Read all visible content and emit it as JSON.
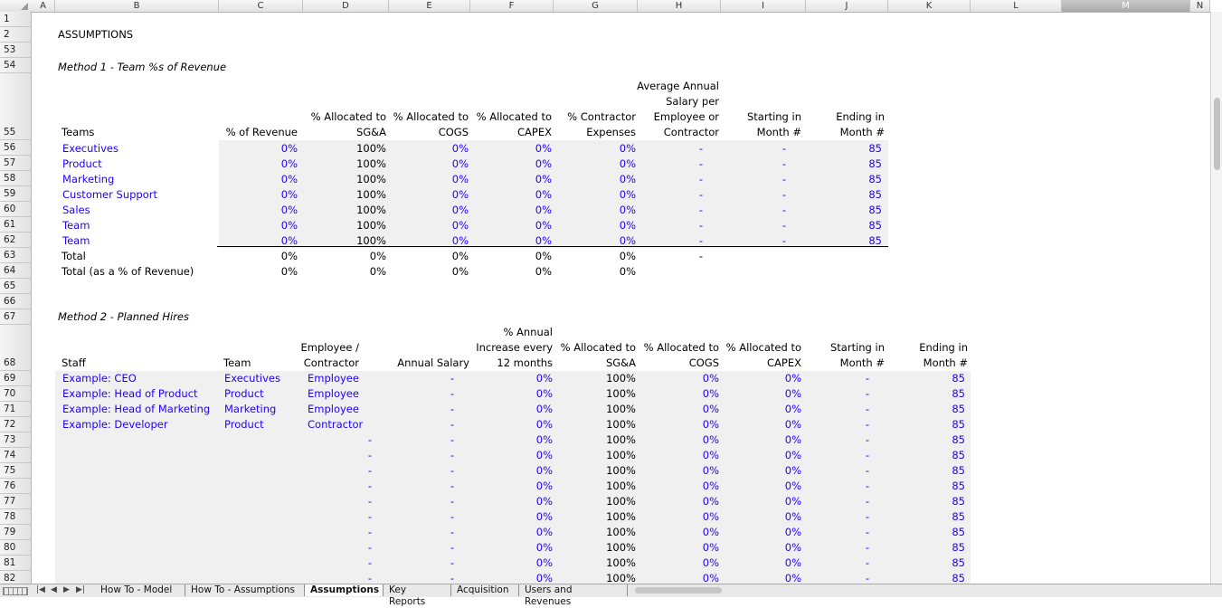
{
  "columns": [
    "A",
    "B",
    "C",
    "D",
    "E",
    "F",
    "G",
    "H",
    "I",
    "J",
    "K",
    "L",
    "M",
    "N"
  ],
  "selected_column": "M",
  "rows": [
    "1",
    "2",
    "53",
    "54",
    "55",
    "56",
    "57",
    "58",
    "59",
    "60",
    "61",
    "62",
    "63",
    "64",
    "65",
    "66",
    "67",
    "68",
    "69",
    "70",
    "71",
    "72",
    "73",
    "74",
    "75",
    "76",
    "77",
    "78",
    "79",
    "80",
    "81",
    "82"
  ],
  "title": "ASSUMPTIONS",
  "method1": {
    "label": "Method 1 - Team %s of Revenue",
    "headers": {
      "teams": "Teams",
      "pct_revenue": "% of Revenue",
      "alloc_sga": [
        "% Allocated to",
        "SG&A"
      ],
      "alloc_cogs": [
        "% Allocated to",
        "COGS"
      ],
      "alloc_capex": [
        "% Allocated to",
        "CAPEX"
      ],
      "contractor": [
        "% Contractor",
        "Expenses"
      ],
      "avg_salary": [
        "Average Annual",
        "Salary per",
        "Employee or",
        "Contractor"
      ],
      "starting": [
        "Starting in",
        "Month #"
      ],
      "ending": [
        "Ending in",
        "Month #"
      ]
    },
    "teams": [
      {
        "name": "Executives",
        "rev": "0%",
        "sga": "100%",
        "cogs": "0%",
        "capex": "0%",
        "contr": "0%",
        "salary": "-",
        "start": "-",
        "end": "85"
      },
      {
        "name": "Product",
        "rev": "0%",
        "sga": "100%",
        "cogs": "0%",
        "capex": "0%",
        "contr": "0%",
        "salary": "-",
        "start": "-",
        "end": "85"
      },
      {
        "name": "Marketing",
        "rev": "0%",
        "sga": "100%",
        "cogs": "0%",
        "capex": "0%",
        "contr": "0%",
        "salary": "-",
        "start": "-",
        "end": "85"
      },
      {
        "name": "Customer Support",
        "rev": "0%",
        "sga": "100%",
        "cogs": "0%",
        "capex": "0%",
        "contr": "0%",
        "salary": "-",
        "start": "-",
        "end": "85"
      },
      {
        "name": "Sales",
        "rev": "0%",
        "sga": "100%",
        "cogs": "0%",
        "capex": "0%",
        "contr": "0%",
        "salary": "-",
        "start": "-",
        "end": "85"
      },
      {
        "name": "Team",
        "rev": "0%",
        "sga": "100%",
        "cogs": "0%",
        "capex": "0%",
        "contr": "0%",
        "salary": "-",
        "start": "-",
        "end": "85"
      },
      {
        "name": "Team",
        "rev": "0%",
        "sga": "100%",
        "cogs": "0%",
        "capex": "0%",
        "contr": "0%",
        "salary": "-",
        "start": "-",
        "end": "85"
      }
    ],
    "total": {
      "label": "Total",
      "rev": "0%",
      "sga": "0%",
      "cogs": "0%",
      "capex": "0%",
      "contr": "0%",
      "salary": "-"
    },
    "total_pct": {
      "label": "Total (as a % of Revenue)",
      "rev": "0%",
      "sga": "0%",
      "cogs": "0%",
      "capex": "0%",
      "contr": "0%"
    }
  },
  "method2": {
    "label": "Method 2 - Planned Hires",
    "headers": {
      "staff": "Staff",
      "team": "Team",
      "emp": [
        "Employee /",
        "Contractor"
      ],
      "salary": "Annual Salary",
      "increase": [
        "% Annual",
        "Increase every",
        "12 months"
      ],
      "sga": [
        "% Allocated to",
        "SG&A"
      ],
      "cogs": [
        "% Allocated to",
        "COGS"
      ],
      "capex": [
        "% Allocated to",
        "CAPEX"
      ],
      "starting": [
        "Starting in",
        "Month #"
      ],
      "ending": [
        "Ending in",
        "Month #"
      ]
    },
    "hires": [
      {
        "staff": "Example: CEO",
        "team": "Executives",
        "emp": "Employee",
        "salary": "-",
        "inc": "0%",
        "sga": "100%",
        "cogs": "0%",
        "capex": "0%",
        "start": "-",
        "end": "85"
      },
      {
        "staff": "Example: Head of Product",
        "team": "Product",
        "emp": "Employee",
        "salary": "-",
        "inc": "0%",
        "sga": "100%",
        "cogs": "0%",
        "capex": "0%",
        "start": "-",
        "end": "85"
      },
      {
        "staff": "Example: Head of Marketing",
        "team": "Marketing",
        "emp": "Employee",
        "salary": "-",
        "inc": "0%",
        "sga": "100%",
        "cogs": "0%",
        "capex": "0%",
        "start": "-",
        "end": "85"
      },
      {
        "staff": "Example: Developer",
        "team": "Product",
        "emp": "Contractor",
        "salary": "-",
        "inc": "0%",
        "sga": "100%",
        "cogs": "0%",
        "capex": "0%",
        "start": "-",
        "end": "85"
      },
      {
        "staff": "",
        "team": "",
        "emp": "-",
        "salary": "-",
        "inc": "0%",
        "sga": "100%",
        "cogs": "0%",
        "capex": "0%",
        "start": "-",
        "end": "85"
      },
      {
        "staff": "",
        "team": "",
        "emp": "-",
        "salary": "-",
        "inc": "0%",
        "sga": "100%",
        "cogs": "0%",
        "capex": "0%",
        "start": "-",
        "end": "85"
      },
      {
        "staff": "",
        "team": "",
        "emp": "-",
        "salary": "-",
        "inc": "0%",
        "sga": "100%",
        "cogs": "0%",
        "capex": "0%",
        "start": "-",
        "end": "85"
      },
      {
        "staff": "",
        "team": "",
        "emp": "-",
        "salary": "-",
        "inc": "0%",
        "sga": "100%",
        "cogs": "0%",
        "capex": "0%",
        "start": "-",
        "end": "85"
      },
      {
        "staff": "",
        "team": "",
        "emp": "-",
        "salary": "-",
        "inc": "0%",
        "sga": "100%",
        "cogs": "0%",
        "capex": "0%",
        "start": "-",
        "end": "85"
      },
      {
        "staff": "",
        "team": "",
        "emp": "-",
        "salary": "-",
        "inc": "0%",
        "sga": "100%",
        "cogs": "0%",
        "capex": "0%",
        "start": "-",
        "end": "85"
      },
      {
        "staff": "",
        "team": "",
        "emp": "-",
        "salary": "-",
        "inc": "0%",
        "sga": "100%",
        "cogs": "0%",
        "capex": "0%",
        "start": "-",
        "end": "85"
      },
      {
        "staff": "",
        "team": "",
        "emp": "-",
        "salary": "-",
        "inc": "0%",
        "sga": "100%",
        "cogs": "0%",
        "capex": "0%",
        "start": "-",
        "end": "85"
      },
      {
        "staff": "",
        "team": "",
        "emp": "-",
        "salary": "-",
        "inc": "0%",
        "sga": "100%",
        "cogs": "0%",
        "capex": "0%",
        "start": "-",
        "end": "85"
      },
      {
        "staff": "",
        "team": "",
        "emp": "-",
        "salary": "-",
        "inc": "0%",
        "sga": "100%",
        "cogs": "0%",
        "capex": "0%",
        "start": "-",
        "end": "85"
      }
    ]
  },
  "sheet_tabs": [
    "How To - Model",
    "How To - Assumptions",
    "Assumptions",
    "Key Reports",
    "Acquisition",
    "Users and Revenues"
  ],
  "active_tab": "Assumptions",
  "nav_icons": [
    "first-sheet-icon",
    "prev-sheet-icon",
    "next-sheet-icon",
    "last-sheet-icon"
  ],
  "colors": {
    "input_blue": "#1f00ff",
    "shade": "#f0f0f0"
  }
}
